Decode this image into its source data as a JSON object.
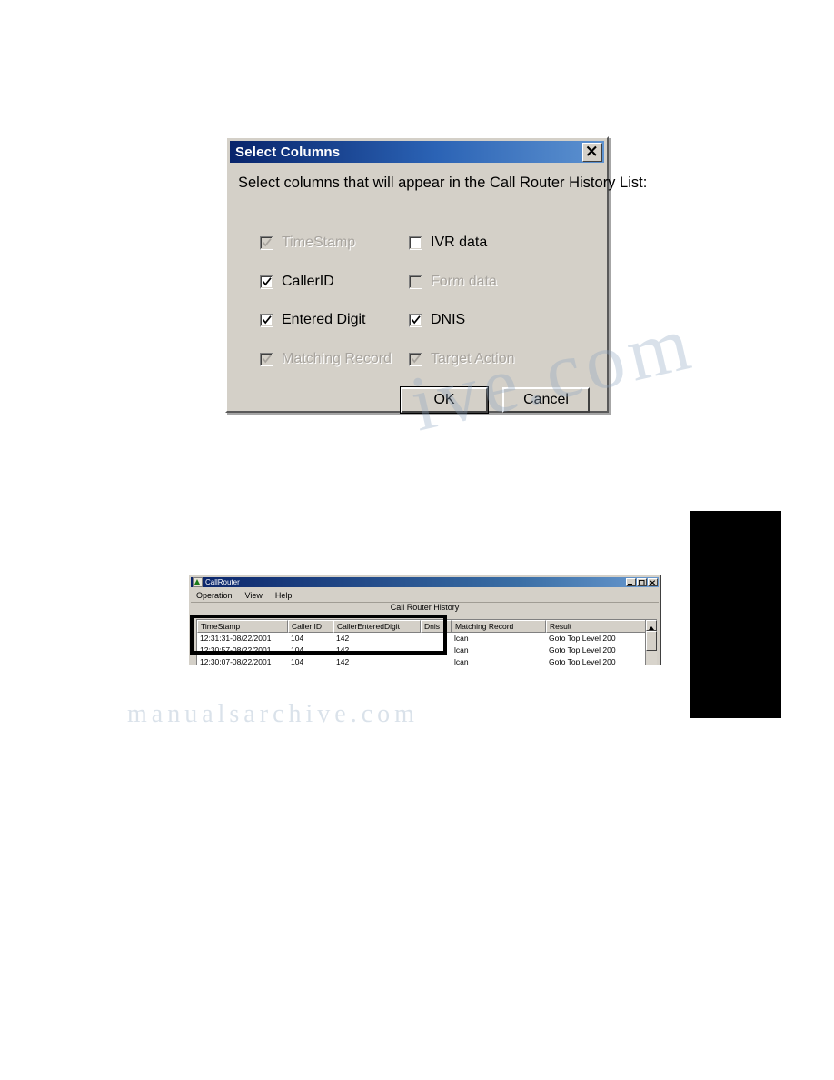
{
  "dialog": {
    "title": "Select Columns",
    "close_icon": "close-icon",
    "instruction": "Select columns that will appear in the Call Router History List:",
    "checkboxes": [
      {
        "label": "TimeStamp",
        "checked": true,
        "disabled": true
      },
      {
        "label": "IVR data",
        "checked": false,
        "disabled": false
      },
      {
        "label": "CallerID",
        "checked": true,
        "disabled": false
      },
      {
        "label": "Form data",
        "checked": false,
        "disabled": true
      },
      {
        "label": "Entered Digit",
        "checked": true,
        "disabled": false
      },
      {
        "label": "DNIS",
        "checked": true,
        "disabled": false
      },
      {
        "label": "Matching Record",
        "checked": true,
        "disabled": true
      },
      {
        "label": "Target Action",
        "checked": true,
        "disabled": true
      }
    ],
    "ok_label": "OK",
    "cancel_label": "Cancel"
  },
  "callrouter": {
    "title": "CallRouter",
    "app_icon": "callrouter-app-icon",
    "window_buttons": [
      "minimize-icon",
      "maximize-icon",
      "close-icon"
    ],
    "menu": [
      "Operation",
      "View",
      "Help"
    ],
    "heading": "Call Router History",
    "columns": [
      "TimeStamp",
      "Caller ID",
      "CallerEnteredDigit",
      "Dnis",
      "Matching Record",
      "Result"
    ],
    "rows": [
      [
        "12:31:31-08/22/2001",
        "104",
        "142",
        "",
        "lcan",
        "Goto Top Level 200"
      ],
      [
        "12:30:57-08/22/2001",
        "104",
        "142",
        "",
        "lcan",
        "Goto Top Level 200"
      ],
      [
        "12:30:07-08/22/2001",
        "104",
        "142",
        "",
        "lcan",
        "Goto Top Level 200"
      ]
    ]
  },
  "watermark": {
    "line1": "ive.com",
    "line2": "manualsarchive.com"
  },
  "colors": {
    "dialog_face": "#d4d0c8",
    "titlebar_start": "#08246b",
    "titlebar_end": "#5d92d0",
    "disabled_text": "#a8a49e"
  }
}
